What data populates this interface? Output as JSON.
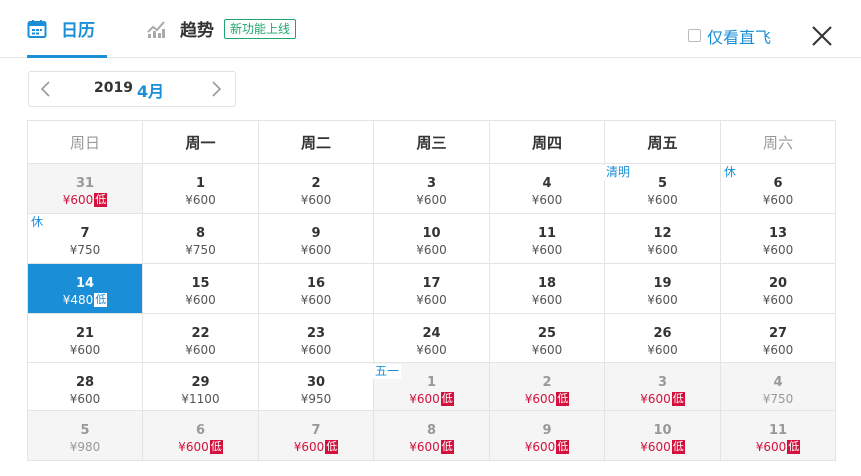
{
  "header": {
    "tab_calendar": "日历",
    "tab_trend": "趋势",
    "new_badge": "新功能上线",
    "direct_only": "仅看直飞"
  },
  "month_selector": {
    "year": "2019",
    "month": "4月"
  },
  "colors": {
    "accent": "#1a8fd8",
    "low_price": "#d4113d",
    "new_badge": "#1fa66a",
    "out_of_month_bg": "#f5f5f5"
  },
  "calendar": {
    "weekdays": [
      "周日",
      "周一",
      "周二",
      "周三",
      "周四",
      "周五",
      "周六"
    ],
    "weeks": [
      [
        {
          "d": "31",
          "p": "¥600",
          "low": true,
          "gray": true
        },
        {
          "d": "1",
          "p": "¥600"
        },
        {
          "d": "2",
          "p": "¥600"
        },
        {
          "d": "3",
          "p": "¥600"
        },
        {
          "d": "4",
          "p": "¥600"
        },
        {
          "d": "5",
          "p": "¥600",
          "hol": "清明"
        },
        {
          "d": "6",
          "p": "¥600",
          "hol": "休"
        }
      ],
      [
        {
          "d": "7",
          "p": "¥750",
          "hol": "休"
        },
        {
          "d": "8",
          "p": "¥750"
        },
        {
          "d": "9",
          "p": "¥600"
        },
        {
          "d": "10",
          "p": "¥600"
        },
        {
          "d": "11",
          "p": "¥600"
        },
        {
          "d": "12",
          "p": "¥600"
        },
        {
          "d": "13",
          "p": "¥600"
        }
      ],
      [
        {
          "d": "14",
          "p": "¥480",
          "low": true,
          "selected": true
        },
        {
          "d": "15",
          "p": "¥600"
        },
        {
          "d": "16",
          "p": "¥600"
        },
        {
          "d": "17",
          "p": "¥600"
        },
        {
          "d": "18",
          "p": "¥600"
        },
        {
          "d": "19",
          "p": "¥600"
        },
        {
          "d": "20",
          "p": "¥600"
        }
      ],
      [
        {
          "d": "21",
          "p": "¥600"
        },
        {
          "d": "22",
          "p": "¥600"
        },
        {
          "d": "23",
          "p": "¥600"
        },
        {
          "d": "24",
          "p": "¥600"
        },
        {
          "d": "25",
          "p": "¥600"
        },
        {
          "d": "26",
          "p": "¥600"
        },
        {
          "d": "27",
          "p": "¥600"
        }
      ],
      [
        {
          "d": "28",
          "p": "¥600"
        },
        {
          "d": "29",
          "p": "¥1100"
        },
        {
          "d": "30",
          "p": "¥950"
        },
        {
          "d": "1",
          "p": "¥600",
          "low": true,
          "gray": true,
          "hol": "五一"
        },
        {
          "d": "2",
          "p": "¥600",
          "low": true,
          "gray": true
        },
        {
          "d": "3",
          "p": "¥600",
          "low": true,
          "gray": true
        },
        {
          "d": "4",
          "p": "¥750",
          "gray": true
        }
      ],
      [
        {
          "d": "5",
          "p": "¥980",
          "gray": true
        },
        {
          "d": "6",
          "p": "¥600",
          "low": true,
          "gray": true
        },
        {
          "d": "7",
          "p": "¥600",
          "low": true,
          "gray": true
        },
        {
          "d": "8",
          "p": "¥600",
          "low": true,
          "gray": true
        },
        {
          "d": "9",
          "p": "¥600",
          "low": true,
          "gray": true
        },
        {
          "d": "10",
          "p": "¥600",
          "low": true,
          "gray": true
        },
        {
          "d": "11",
          "p": "¥600",
          "low": true,
          "gray": true
        }
      ]
    ],
    "low_label": "低"
  }
}
